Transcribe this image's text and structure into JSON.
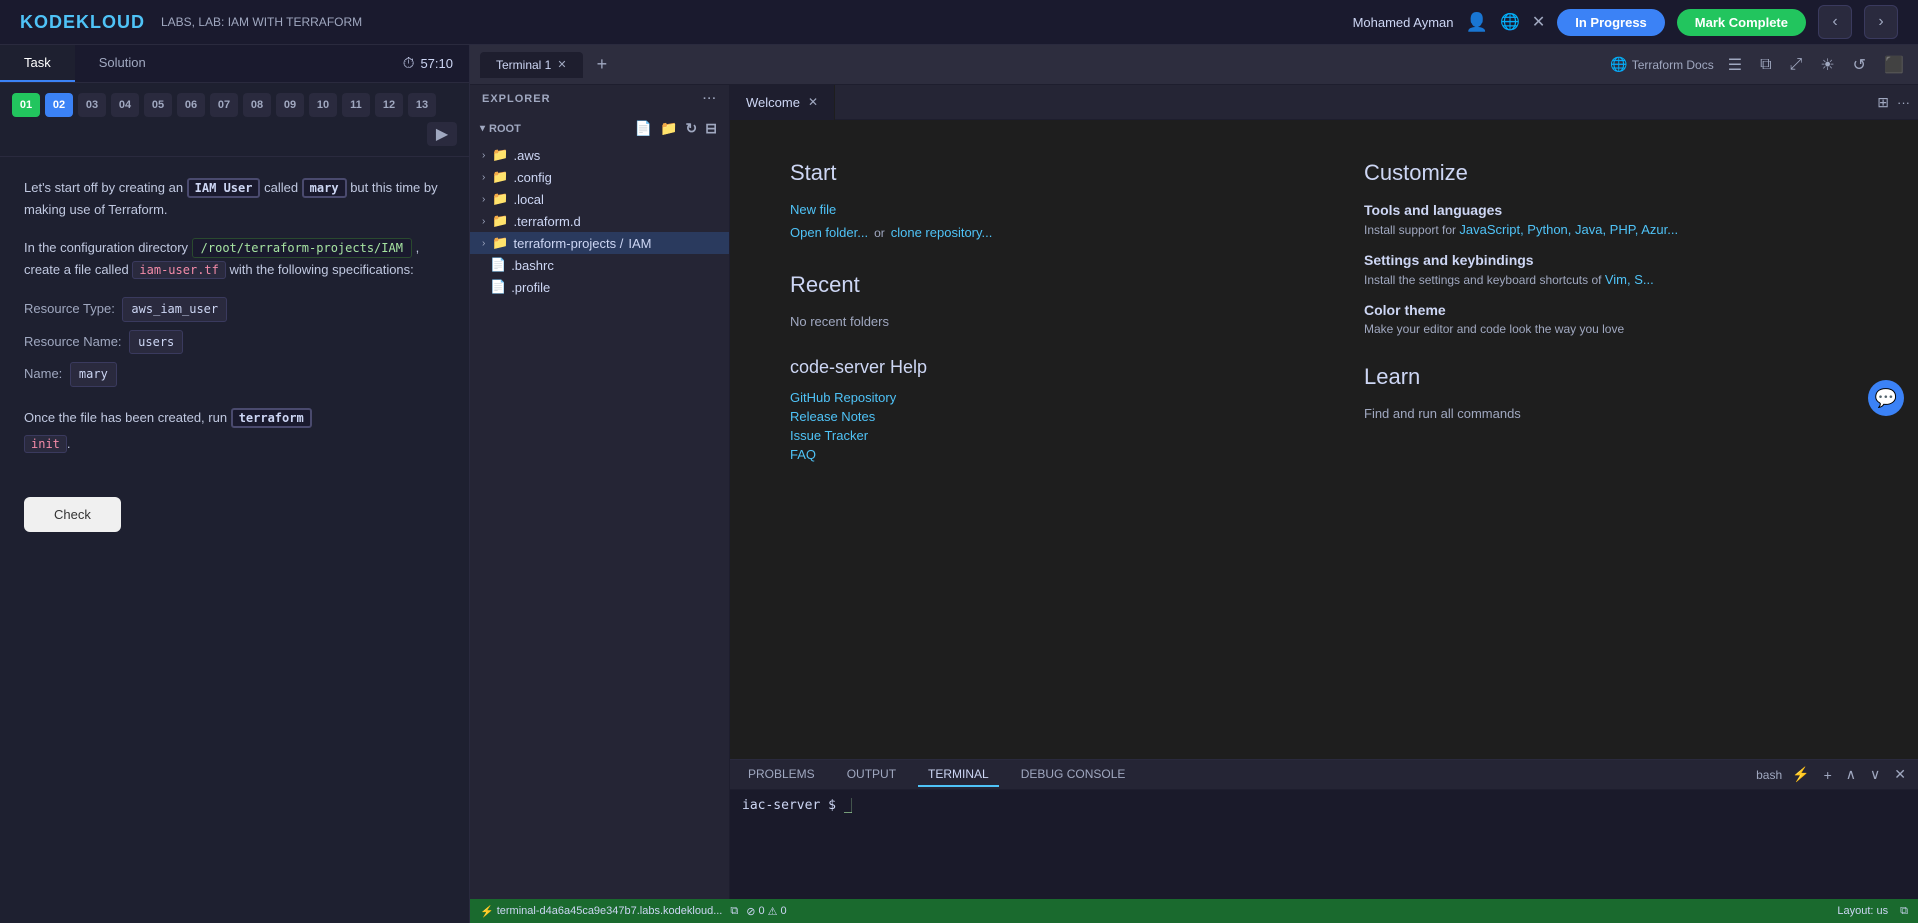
{
  "topbar": {
    "logo": "KODEKLOUD",
    "lab_title": "LABS, LAB: IAM WITH TERRAFORM",
    "user_name": "Mohamed Ayman",
    "in_progress_label": "In Progress",
    "mark_complete_label": "Mark Complete"
  },
  "left_panel": {
    "tab_task": "Task",
    "tab_solution": "Solution",
    "timer": "57:10",
    "steps": [
      "01",
      "02",
      "03",
      "04",
      "05",
      "06",
      "07",
      "08",
      "09",
      "10",
      "11",
      "12",
      "13"
    ],
    "content": {
      "para1_before": "Let's start off by creating an",
      "iam_user_highlight": "IAM User",
      "para1_after": "called",
      "name_mary": "mary",
      "para1_rest": "but this time by making use of Terraform.",
      "para2": "In the configuration directory",
      "path": "/root/terraform-projects/IAM",
      "para2_rest": ", create a file called",
      "filename": "iam-user.tf",
      "para2_end": "with the following specifications:",
      "resource_type_label": "Resource Type:",
      "resource_type_val": "aws_iam_user",
      "resource_name_label": "Resource Name:",
      "resource_name_val": "users",
      "name_label": "Name:",
      "name_val": "mary",
      "para3_before": "Once the file has been created, run",
      "terraform_cmd": "terraform",
      "para3_init": "init",
      "check_btn": "Check"
    }
  },
  "vscode": {
    "terminal_tab": "Terminal 1",
    "add_tab": "+",
    "terraform_docs": "Terraform Docs",
    "explorer_title": "EXPLORER",
    "explorer_more": "...",
    "root_label": "ROOT",
    "tree": {
      "aws": ".aws",
      "config": ".config",
      "local": ".local",
      "terraform_d": ".terraform.d",
      "terraform_projects": "terraform-projects",
      "iam_folder": "IAM",
      "bashrc": ".bashrc",
      "profile": ".profile"
    },
    "file_actions": {
      "new_file": "New file",
      "new_folder": "New folder",
      "refresh": "Refresh",
      "collapse": "Collapse"
    },
    "welcome_tab": "Welcome",
    "welcome": {
      "start_title": "Start",
      "new_file": "New file",
      "open_folder": "Open folder...",
      "or": "or",
      "clone_repo": "clone repository...",
      "recent_title": "Recent",
      "no_recent": "No recent folders",
      "help_title": "code-server Help",
      "github_repo": "GitHub Repository",
      "release_notes": "Release Notes",
      "issue_tracker": "Issue Tracker",
      "faq": "FAQ",
      "customize_title": "Customize",
      "tools_title": "Tools and languages",
      "tools_sub_before": "Install support for",
      "tools_sub_langs": "JavaScript, Python, Java, PHP, Azur...",
      "settings_title": "Settings and keybindings",
      "settings_sub_before": "Install the settings and keyboard shortcuts of",
      "settings_sub_editors": "Vim, S...",
      "color_theme_title": "Color theme",
      "color_theme_sub": "Make your editor and code look the way you love",
      "learn_title": "Learn",
      "find_commands": "Find and run all commands"
    },
    "terminal": {
      "problems_tab": "PROBLEMS",
      "output_tab": "OUTPUT",
      "terminal_tab": "TERMINAL",
      "debug_tab": "DEBUG CONSOLE",
      "shell": "bash",
      "prompt": "iac-server $ "
    },
    "statusbar": {
      "terminal_path": "terminal-d4a6a45ca9e347b7.labs.kodekloud...",
      "errors": "0",
      "warnings": "0",
      "layout": "Layout: us"
    }
  }
}
